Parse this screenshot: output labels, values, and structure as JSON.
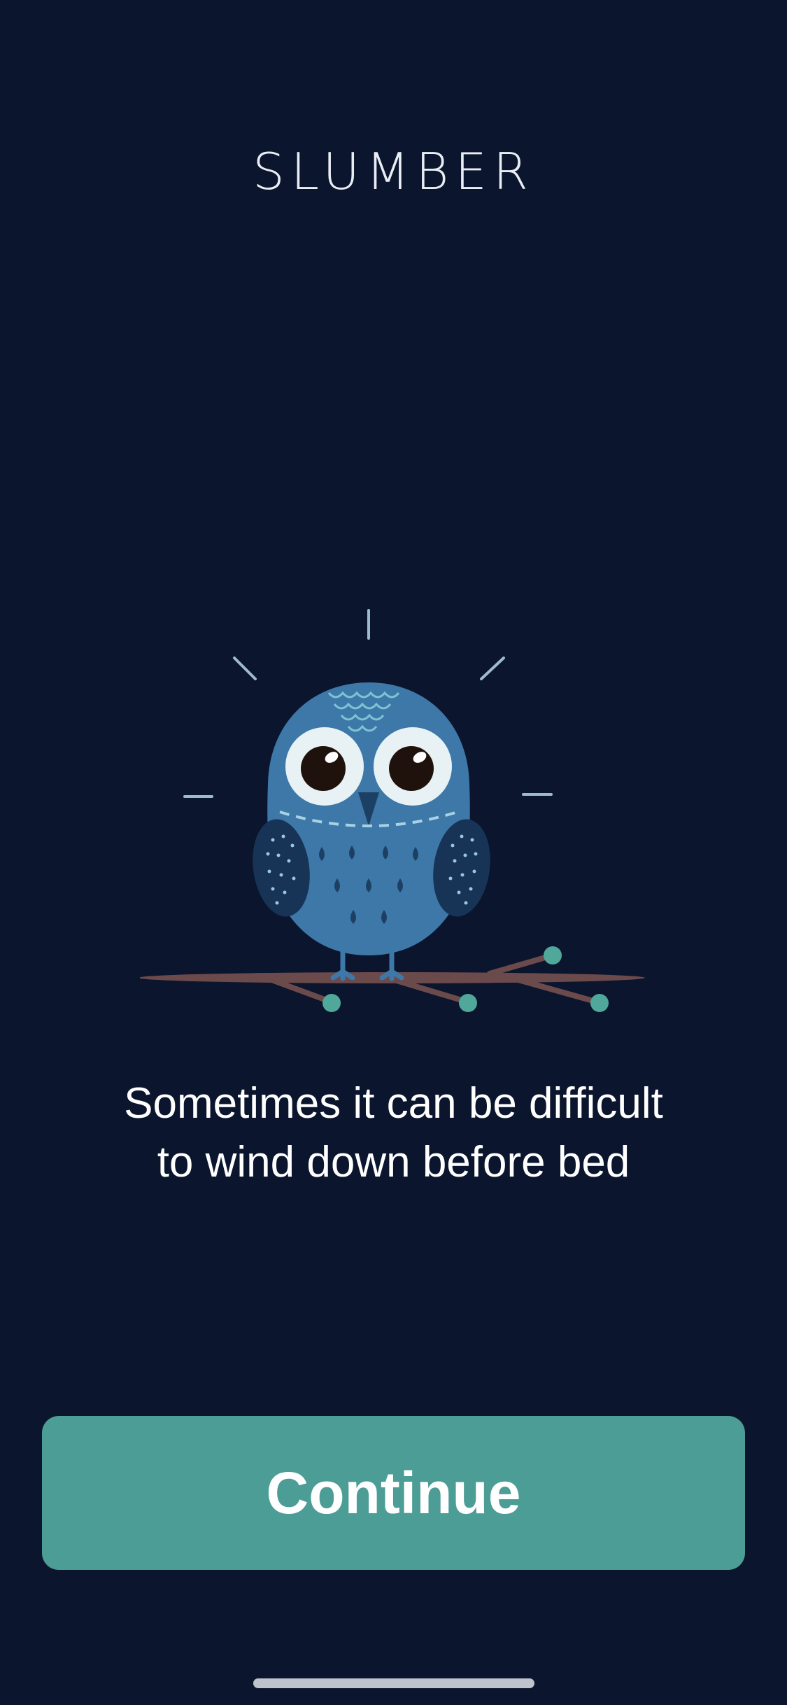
{
  "header": {
    "app_name": "SLUMBER"
  },
  "onboarding": {
    "illustration_icon": "owl-on-branch",
    "message_line1": "Sometimes it can be difficult",
    "message_line2": "to wind down before bed"
  },
  "actions": {
    "continue_label": "Continue"
  },
  "colors": {
    "background": "#0b152d",
    "accent": "#4c9d96",
    "owl_body": "#3d78a8",
    "branch": "#6b4a4c",
    "berry": "#4fa89a"
  }
}
